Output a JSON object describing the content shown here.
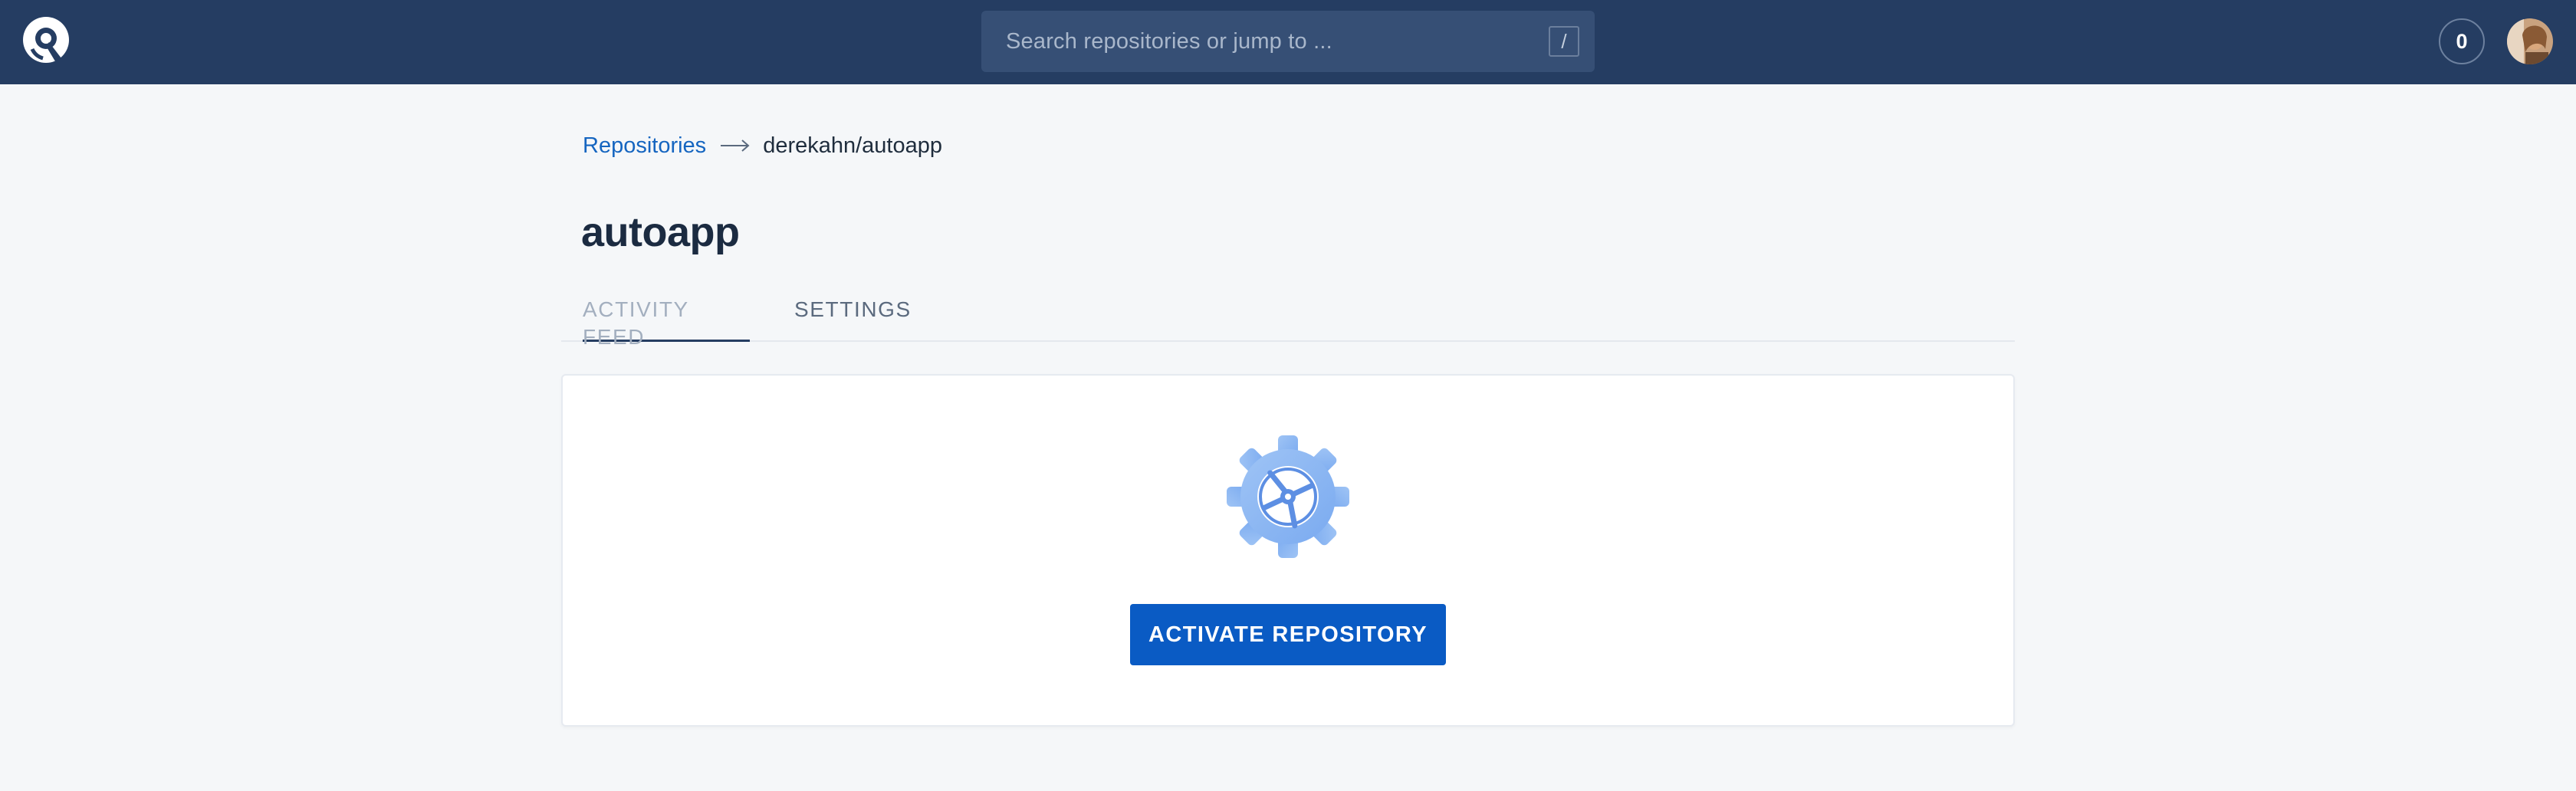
{
  "nav": {
    "logo_icon": "app-logo-icon",
    "search_placeholder": "Search repositories or jump to ...",
    "search_shortcut": "/",
    "notification_count": "0",
    "avatar_icon": "user-avatar"
  },
  "breadcrumb": {
    "root_label": "Repositories",
    "separator_icon": "arrow-right-icon",
    "current_label": "derekahn/autoapp"
  },
  "page": {
    "title": "autoapp"
  },
  "tabs": [
    {
      "label": "ACTIVITY FEED",
      "active": true
    },
    {
      "label": "SETTINGS",
      "active": false
    }
  ],
  "card": {
    "illustration_icon": "gear-icon",
    "activate_label": "ACTIVATE REPOSITORY"
  },
  "colors": {
    "nav_bg": "#253d62",
    "search_bg": "#364f75",
    "link": "#1565c0",
    "primary_button": "#0a5bc4",
    "page_bg": "#f5f7f9"
  }
}
